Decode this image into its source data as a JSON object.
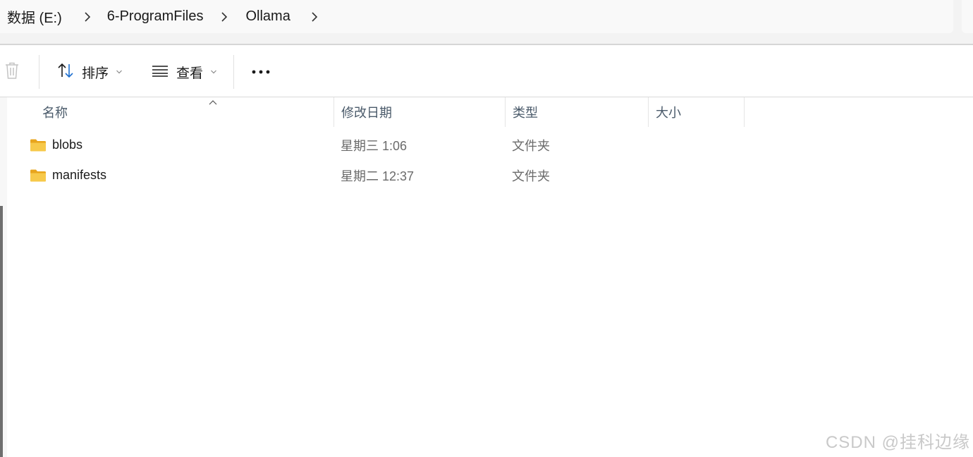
{
  "breadcrumb": {
    "items": [
      {
        "label": "数据 (E:)"
      },
      {
        "label": "6-ProgramFiles"
      },
      {
        "label": "Ollama"
      }
    ]
  },
  "toolbar": {
    "sort_label": "排序",
    "view_label": "查看",
    "more_label": "•••"
  },
  "columns": {
    "name": "名称",
    "date": "修改日期",
    "type": "类型",
    "size": "大小"
  },
  "files": [
    {
      "name": "blobs",
      "date": "星期三 1:06",
      "type": "文件夹",
      "size": ""
    },
    {
      "name": "manifests",
      "date": "星期二 12:37",
      "type": "文件夹",
      "size": ""
    }
  ],
  "watermark": "CSDN @挂科边缘",
  "colors": {
    "folder_yellow": "#f7c94a",
    "folder_dark": "#e8a51d",
    "accent_blue": "#1e6fcf"
  },
  "icons": [
    "chevron-right-icon",
    "trash-icon",
    "sort-icon",
    "view-list-icon",
    "more-icon",
    "folder-icon",
    "sort-up-arrow-icon"
  ]
}
